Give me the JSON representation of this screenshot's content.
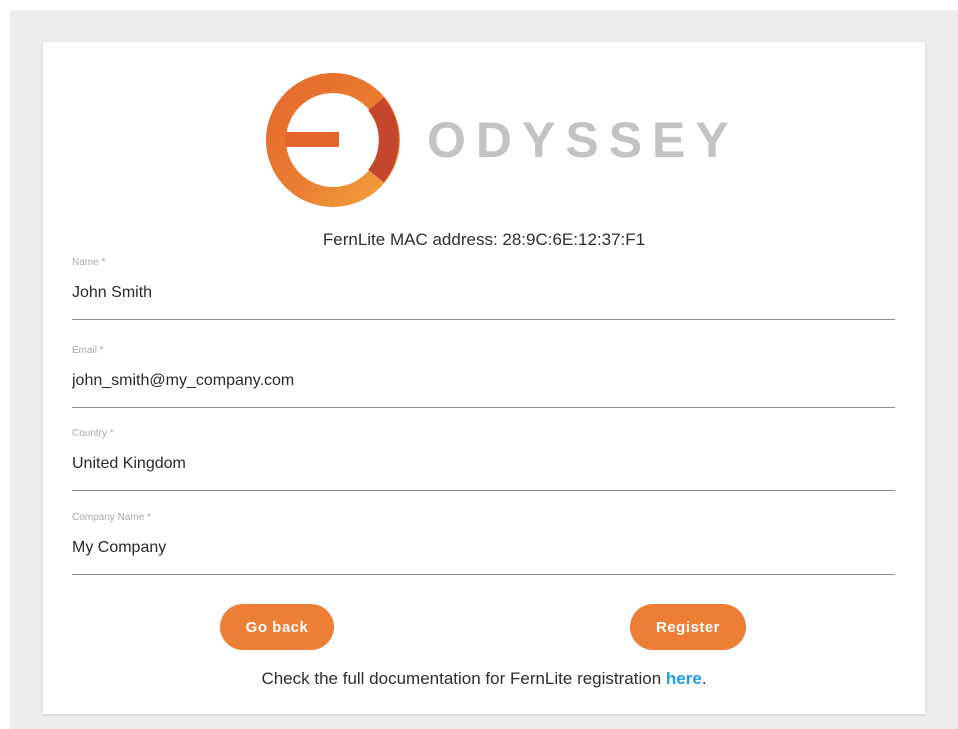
{
  "brand": {
    "name": "ODYSSEY",
    "colors": {
      "orange_light": "#f0a13a",
      "orange": "#e6772e",
      "orange_dark": "#c2452c",
      "wordmark": "#c3c3c3"
    }
  },
  "mac_line": "FernLite MAC address: 28:9C:6E:12:37:F1",
  "fields": [
    {
      "label": "Name *",
      "value": "John Smith"
    },
    {
      "label": "Email *",
      "value": "john_smith@my_company.com"
    },
    {
      "label": "Country *",
      "value": "United Kingdom"
    },
    {
      "label": "Company Name *",
      "value": "My Company"
    }
  ],
  "buttons": {
    "back": "Go back",
    "register": "Register",
    "color": "#ec7f35"
  },
  "doc": {
    "text": "Check the full documentation for FernLite registration ",
    "link": "here",
    "suffix": "."
  }
}
